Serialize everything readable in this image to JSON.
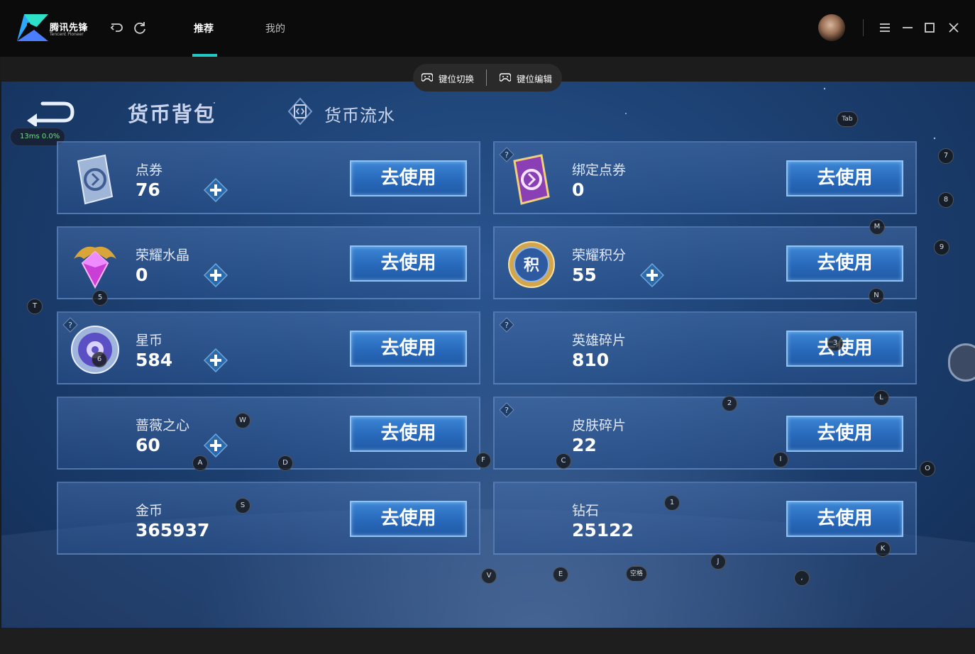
{
  "app": {
    "logo_text": "腾讯先锋",
    "logo_sub": "Tencent Pioneer",
    "tabs": [
      {
        "label": "推荐",
        "active": true
      },
      {
        "label": "我的",
        "active": false
      }
    ],
    "accent_color": "#1ec9c8"
  },
  "keybar": {
    "switch_label": "键位切换",
    "edit_label": "键位编辑"
  },
  "overlay": {
    "perf": "13ms  0.0%"
  },
  "header": {
    "tab_backpack": "货币背包",
    "tab_flow": "货币流水"
  },
  "cards": [
    {
      "name": "点券",
      "value": "76",
      "button": "去使用",
      "icon": "ticket-card-icon",
      "plus": true,
      "help": false
    },
    {
      "name": "绑定点券",
      "value": "0",
      "button": "去使用",
      "icon": "bound-ticket-card-icon",
      "plus": false,
      "help": true
    },
    {
      "name": "荣耀水晶",
      "value": "0",
      "button": "去使用",
      "icon": "glory-crystal-icon",
      "plus": true,
      "help": false
    },
    {
      "name": "荣耀积分",
      "value": "55",
      "button": "去使用",
      "icon": "glory-points-icon",
      "plus": true,
      "help": false
    },
    {
      "name": "星币",
      "value": "584",
      "button": "去使用",
      "icon": "star-coin-icon",
      "plus": true,
      "help": true
    },
    {
      "name": "英雄碎片",
      "value": "810",
      "button": "去使用",
      "icon": "",
      "plus": false,
      "help": true
    },
    {
      "name": "蔷薇之心",
      "value": "60",
      "button": "去使用",
      "icon": "",
      "plus": true,
      "help": false
    },
    {
      "name": "皮肤碎片",
      "value": "22",
      "button": "去使用",
      "icon": "",
      "plus": false,
      "help": true
    },
    {
      "name": "金币",
      "value": "365937",
      "button": "去使用",
      "icon": "",
      "plus": false,
      "help": false
    },
    {
      "name": "钻石",
      "value": "25122",
      "button": "去使用",
      "icon": "",
      "plus": false,
      "help": false
    }
  ],
  "keys": [
    "Tab",
    "7",
    "8",
    "M",
    "9",
    "5",
    "N",
    "T",
    "6",
    "3",
    "L",
    "2",
    "W",
    "O",
    "A",
    "D",
    "F",
    "C",
    "I",
    "S",
    "1",
    "K",
    "J",
    "V",
    "E",
    "空格",
    ","
  ]
}
